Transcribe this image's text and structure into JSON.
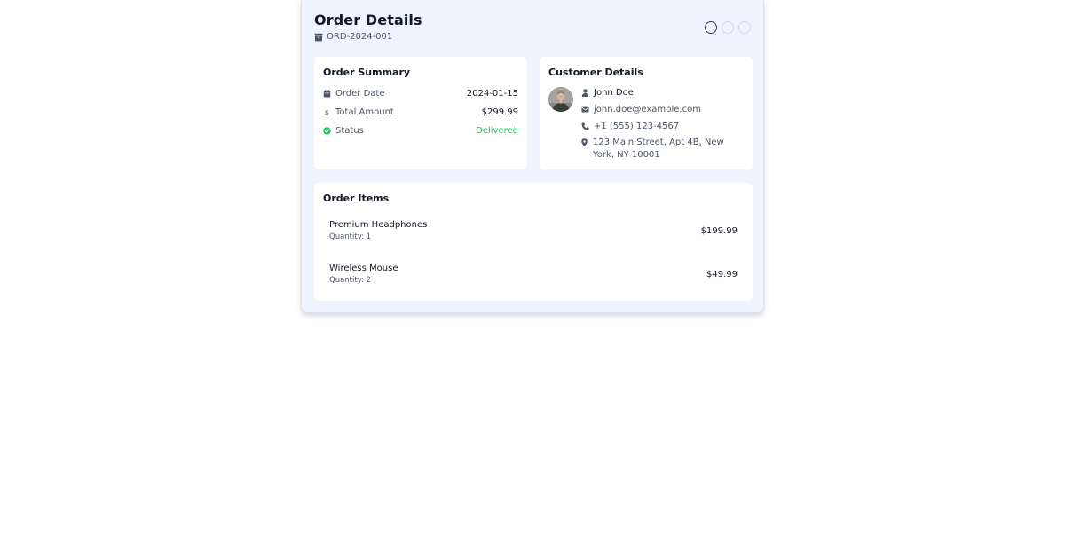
{
  "header": {
    "title": "Order Details",
    "order_id": "ORD-2024-001",
    "steps": [
      {
        "active": true
      },
      {
        "active": false
      },
      {
        "active": false
      }
    ]
  },
  "summary": {
    "title": "Order Summary",
    "rows": [
      {
        "label": "Order Date",
        "value": "2024-01-15",
        "icon": "calendar-icon"
      },
      {
        "label": "Total Amount",
        "value": "$299.99",
        "icon": "dollar-icon"
      },
      {
        "label": "Status",
        "value": "Delivered",
        "icon": "check-circle-icon"
      }
    ]
  },
  "customer": {
    "title": "Customer Details",
    "name": "John Doe",
    "email": "john.doe@example.com",
    "phone": "+1 (555) 123-4567",
    "address": "123 Main Street, Apt 4B, New York, NY 10001"
  },
  "items": {
    "title": "Order Items",
    "list": [
      {
        "name": "Premium Headphones",
        "quantity": "Quantity: 1",
        "price": "$199.99"
      },
      {
        "name": "Wireless Mouse",
        "quantity": "Quantity: 2",
        "price": "$49.99"
      }
    ]
  },
  "colors": {
    "card_bg": "#eef4fd",
    "status_delivered": "#22c55e",
    "text_primary": "#111827",
    "text_muted": "#4b5563"
  }
}
